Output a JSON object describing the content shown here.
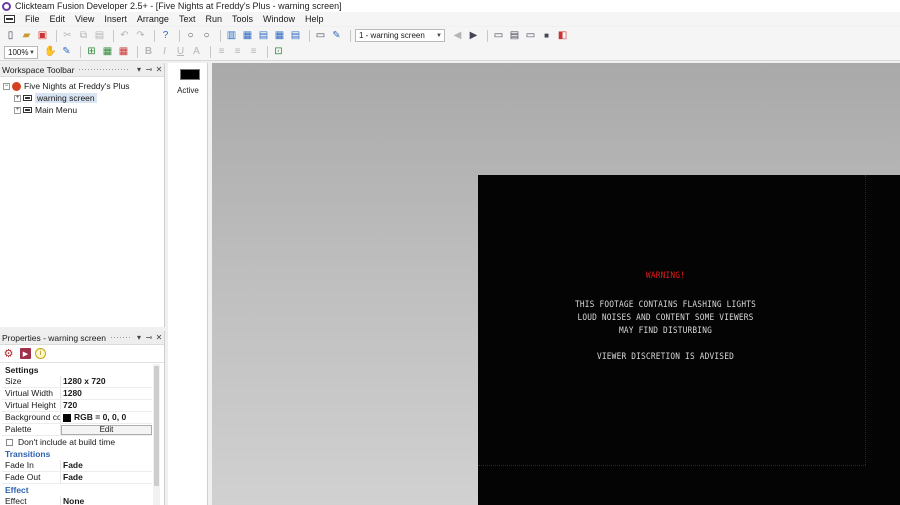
{
  "window": {
    "title": "Clickteam Fusion Developer 2.5+ - [Five Nights at Freddy's Plus - warning screen]"
  },
  "menu": [
    "File",
    "Edit",
    "View",
    "Insert",
    "Arrange",
    "Text",
    "Run",
    "Tools",
    "Window",
    "Help"
  ],
  "toolbar": {
    "frame_select_value": "1 - warning screen",
    "zoom_value": "100%"
  },
  "workspace_toolbar": {
    "title": "Workspace Toolbar",
    "app_name": "Five Nights at Freddy's Plus",
    "frames": [
      "warning screen",
      "Main Menu"
    ]
  },
  "properties": {
    "title": "Properties - warning screen",
    "settings_label": "Settings",
    "rows": [
      {
        "key": "Size",
        "value": "1280 x 720"
      },
      {
        "key": "Virtual Width",
        "value": "1280"
      },
      {
        "key": "Virtual Height",
        "value": "720"
      }
    ],
    "background_key": "Background colo",
    "background_value": "RGB = 0, 0, 0",
    "background_color": "#000000",
    "palette_key": "Palette",
    "palette_button": "Edit",
    "dont_include_label": "Don't include at build time",
    "transitions_label": "Transitions",
    "fade_in_key": "Fade In",
    "fade_in_value": "Fade",
    "fade_out_key": "Fade Out",
    "fade_out_value": "Fade",
    "effect_group_label": "Effect",
    "effect_key": "Effect",
    "effect_value": "None"
  },
  "layers": {
    "active_label": "Active"
  },
  "frame_content": {
    "warning": "WARNING!",
    "line1": "THIS FOOTAGE CONTAINS FLASHING LIGHTS",
    "line2": "LOUD NOISES AND CONTENT SOME VIEWERS",
    "line3": "MAY FIND DISTURBING",
    "line4": "VIEWER DISCRETION IS ADVISED",
    "warning_color": "#e21b1b",
    "text_color": "#d8d8d8",
    "background_color": "#040404"
  }
}
